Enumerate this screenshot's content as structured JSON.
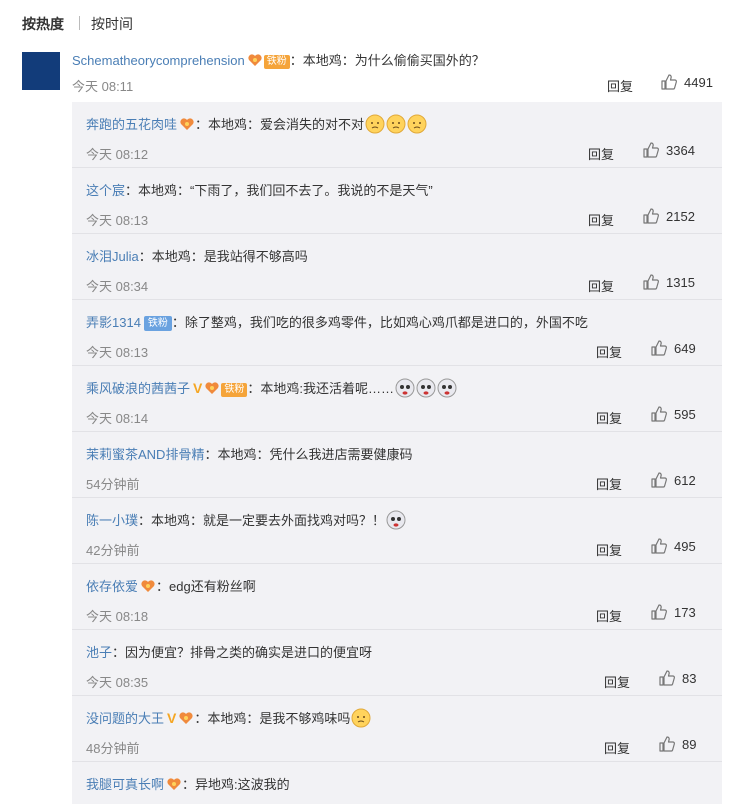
{
  "sort": {
    "hot": "按热度",
    "time": "按时间"
  },
  "top_comment": {
    "username": "Schematheorycomprehension",
    "iron_badge": "铁粉",
    "text": "：本地鸡：为什么偷偷买国外的？",
    "time": "今天 08:11",
    "reply_label": "回复",
    "likes": "4491"
  },
  "replies": [
    {
      "username": "奔跑的五花肉哇",
      "text": "：本地鸡：爱会消失的对不对",
      "time": "今天 08:12",
      "reply_label": "回复",
      "likes": "3364"
    },
    {
      "username": "这个宸",
      "text": "：本地鸡：“下雨了，我们回不去了。我说的不是天气”",
      "time": "今天 08:13",
      "reply_label": "回复",
      "likes": "2152"
    },
    {
      "username": "冰泪Julia",
      "text": "：本地鸡：是我站得不够高吗",
      "time": "今天 08:34",
      "reply_label": "回复",
      "likes": "1315"
    },
    {
      "username": "弄影1314",
      "badge": "铁粉",
      "text": "：除了整鸡，我们吃的很多鸡零件，比如鸡心鸡爪都是进口的，外国不吃",
      "time": "今天 08:13",
      "reply_label": "回复",
      "likes": "649"
    },
    {
      "username": "乘风破浪的茜茜子",
      "badge": "铁粉",
      "text": "：本地鸡:我还活着呢……",
      "time": "今天 08:14",
      "reply_label": "回复",
      "likes": "595"
    },
    {
      "username": "茉莉蜜茶AND排骨精",
      "text": "：本地鸡：凭什么我进店需要健康码",
      "time": "54分钟前",
      "reply_label": "回复",
      "likes": "612"
    },
    {
      "username": "陈一小璞",
      "text": "：本地鸡：就是一定要去外面找鸡对吗？！",
      "time": "42分钟前",
      "reply_label": "回复",
      "likes": "495"
    },
    {
      "username": "依存依爱",
      "text": "：edg还有粉丝啊",
      "time": "今天 08:18",
      "reply_label": "回复",
      "likes": "173"
    },
    {
      "username": "池子",
      "text": "：因为便宜？排骨之类的确实是进口的便宜呀",
      "time": "今天 08:35",
      "reply_label": "回复",
      "likes": "83"
    },
    {
      "username": "没问题的大王",
      "text": "：本地鸡：是我不够鸡味吗",
      "time": "48分钟前",
      "reply_label": "回复",
      "likes": "89"
    },
    {
      "username": "我腿可真长啊",
      "text": "：异地鸡:这波我的"
    }
  ],
  "colors": {
    "link": "#4a7eb5",
    "reply_bg": "#f2f2f5",
    "badge": "#f5a43a",
    "vip": "#f5a623"
  }
}
